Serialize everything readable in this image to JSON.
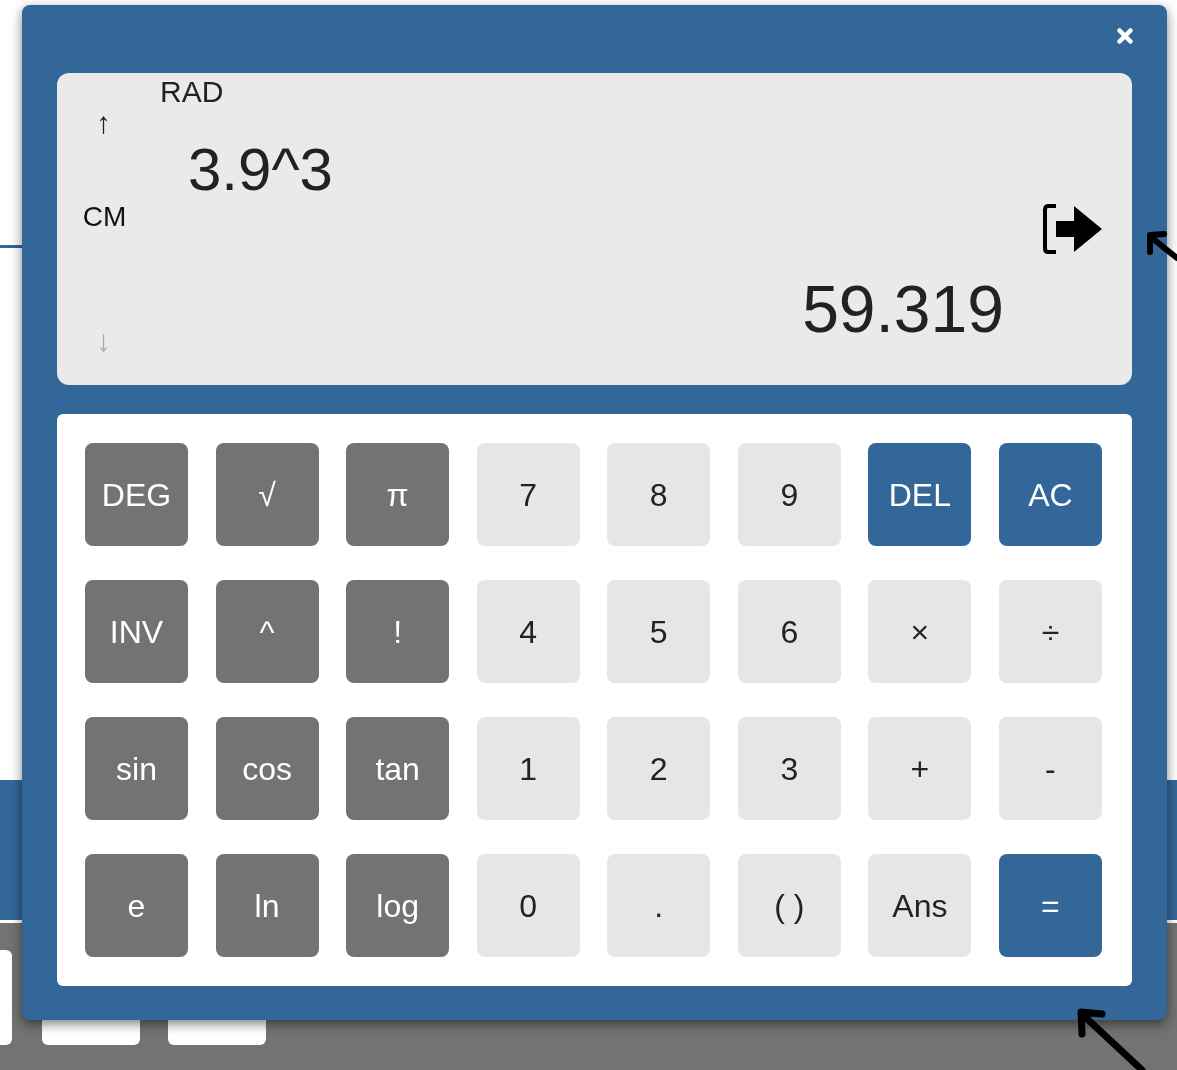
{
  "display": {
    "angle_mode": "RAD",
    "unit": "CM",
    "expression": "3.9^3",
    "result": "59.319",
    "history_up": {
      "label": "↑",
      "enabled": true
    },
    "history_down": {
      "label": "↓",
      "enabled": false
    }
  },
  "keys": [
    {
      "label": "DEG",
      "kind": "function"
    },
    {
      "label": "√",
      "kind": "function"
    },
    {
      "label": "π",
      "kind": "function"
    },
    {
      "label": "7",
      "kind": "digit"
    },
    {
      "label": "8",
      "kind": "digit"
    },
    {
      "label": "9",
      "kind": "digit"
    },
    {
      "label": "DEL",
      "kind": "accent"
    },
    {
      "label": "AC",
      "kind": "accent"
    },
    {
      "label": "INV",
      "kind": "function"
    },
    {
      "label": "^",
      "kind": "function"
    },
    {
      "label": "!",
      "kind": "function"
    },
    {
      "label": "4",
      "kind": "digit"
    },
    {
      "label": "5",
      "kind": "digit"
    },
    {
      "label": "6",
      "kind": "digit"
    },
    {
      "label": "×",
      "kind": "digit"
    },
    {
      "label": "÷",
      "kind": "digit"
    },
    {
      "label": "sin",
      "kind": "function"
    },
    {
      "label": "cos",
      "kind": "function"
    },
    {
      "label": "tan",
      "kind": "function"
    },
    {
      "label": "1",
      "kind": "digit"
    },
    {
      "label": "2",
      "kind": "digit"
    },
    {
      "label": "3",
      "kind": "digit"
    },
    {
      "label": "+",
      "kind": "digit"
    },
    {
      "label": "-",
      "kind": "digit"
    },
    {
      "label": "e",
      "kind": "function"
    },
    {
      "label": "ln",
      "kind": "function"
    },
    {
      "label": "log",
      "kind": "function"
    },
    {
      "label": "0",
      "kind": "digit"
    },
    {
      "label": ".",
      "kind": "digit"
    },
    {
      "label": "( )",
      "kind": "digit"
    },
    {
      "label": "Ans",
      "kind": "digit"
    },
    {
      "label": "=",
      "kind": "accent"
    }
  ]
}
